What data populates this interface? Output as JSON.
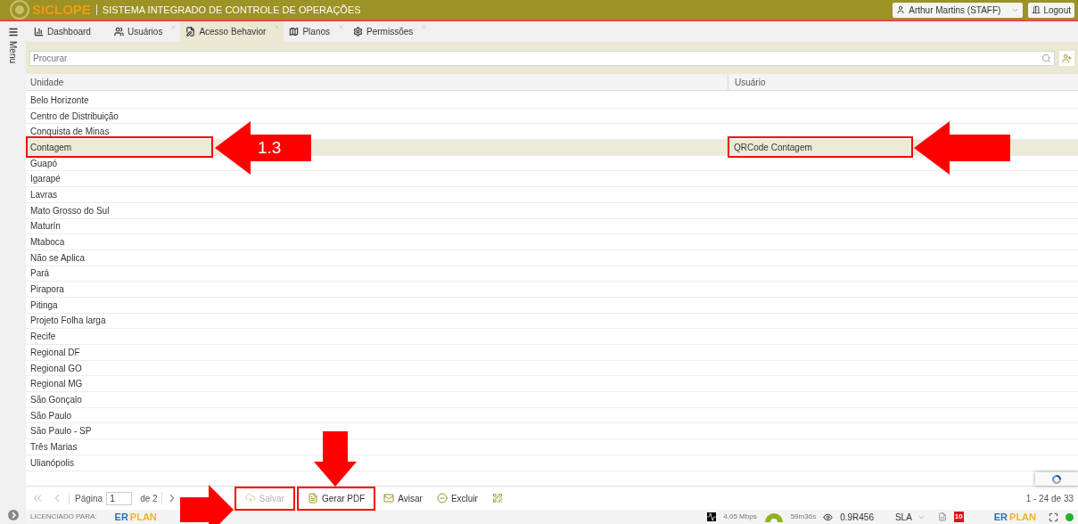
{
  "header": {
    "logo": "SICLOPE",
    "title": "SISTEMA INTEGRADO DE CONTROLE DE OPERAÇÕES",
    "user": "Arthur Martins (STAFF)",
    "logout": "Logout"
  },
  "sidebar": {
    "label": "Menu"
  },
  "tabs": [
    {
      "label": "Dashboard",
      "kind": "chart",
      "selected": false,
      "closable": false
    },
    {
      "label": "Usuários",
      "kind": "users",
      "selected": false,
      "closable": true
    },
    {
      "label": "Acesso Behavior",
      "kind": "edit",
      "selected": true,
      "closable": true
    },
    {
      "label": "Planos",
      "kind": "map",
      "selected": false,
      "closable": true
    },
    {
      "label": "Permissões",
      "kind": "gear",
      "selected": false,
      "closable": true
    }
  ],
  "search": {
    "placeholder": "Procurar"
  },
  "table": {
    "columns": [
      "Unidade",
      "Usuário"
    ],
    "rows": [
      {
        "unidade": "Belo Horizonte",
        "selected": false
      },
      {
        "unidade": "Centro de Distribuição",
        "selected": false
      },
      {
        "unidade": "Conquista de Minas",
        "selected": false
      },
      {
        "unidade": "Contagem",
        "usuario": "QRCode Contagem",
        "selected": true,
        "unit_callout": {
          "kind": "arrow-left",
          "label": "1.3"
        },
        "user_callout": {
          "kind": "arrow-left"
        }
      },
      {
        "unidade": "Guapó",
        "selected": false
      },
      {
        "unidade": "Igarapé",
        "selected": false
      },
      {
        "unidade": "Lavras",
        "selected": false
      },
      {
        "unidade": "Mato Grosso do Sul",
        "selected": false
      },
      {
        "unidade": "Maturín",
        "selected": false
      },
      {
        "unidade": "Mtaboca",
        "selected": false
      },
      {
        "unidade": "Não se Aplica",
        "selected": false
      },
      {
        "unidade": "Pará",
        "selected": false
      },
      {
        "unidade": "Pirapora",
        "selected": false
      },
      {
        "unidade": "Pitinga",
        "selected": false
      },
      {
        "unidade": "Projeto Folha larga",
        "selected": false
      },
      {
        "unidade": "Recife",
        "selected": false
      },
      {
        "unidade": "Regional DF",
        "selected": false
      },
      {
        "unidade": "Regional GO",
        "selected": false
      },
      {
        "unidade": "Regional MG",
        "selected": false
      },
      {
        "unidade": "São Gonçalo",
        "selected": false
      },
      {
        "unidade": "São Paulo",
        "selected": false
      },
      {
        "unidade": "São Paulo - SP",
        "selected": false
      },
      {
        "unidade": "Três Marias",
        "selected": false
      },
      {
        "unidade": "Ulianópolis",
        "selected": false
      }
    ]
  },
  "pagination": {
    "page_label": "Página",
    "page": "1",
    "of": "de 2",
    "range": "1 - 24 de 33"
  },
  "toolbar": [
    {
      "kind": "save",
      "label": "Salvar",
      "disabled": true,
      "callout": {
        "kind": "arrow-right"
      }
    },
    {
      "kind": "pdf",
      "label": "Gerar PDF",
      "disabled": false,
      "callout": {
        "kind": "arrow-down"
      }
    },
    {
      "kind": "notify",
      "label": "Avisar",
      "disabled": false
    },
    {
      "kind": "delete",
      "label": "Excluir",
      "disabled": false
    },
    {
      "kind": "qr",
      "disabled": false
    }
  ],
  "status": {
    "license_label": "LICENCIADO PARA:",
    "brand_left": [
      "ER",
      "PLAN"
    ],
    "speed": "4.05 Mbps",
    "timer": "59m36s",
    "version": "0.9R456",
    "sla": "SLA",
    "alerts": "10",
    "brand_right": [
      "ER",
      "PLAN"
    ],
    "online": true
  }
}
